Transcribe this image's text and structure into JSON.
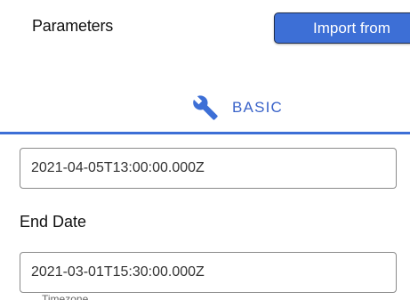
{
  "header": {
    "title": "Parameters",
    "import_label": "Import from"
  },
  "tabs": [
    {
      "label": "BASIC",
      "icon": "wrench-icon",
      "selected": true
    }
  ],
  "fields": {
    "start_date_value": "2021-04-05T13:00:00.000Z",
    "end_date_label": "End Date",
    "end_date_value": "2021-03-01T15:30:00.000Z",
    "timezone_label": "Timezone"
  },
  "colors": {
    "accent": "#3d6fd6",
    "tab_text": "#3a63c9"
  }
}
